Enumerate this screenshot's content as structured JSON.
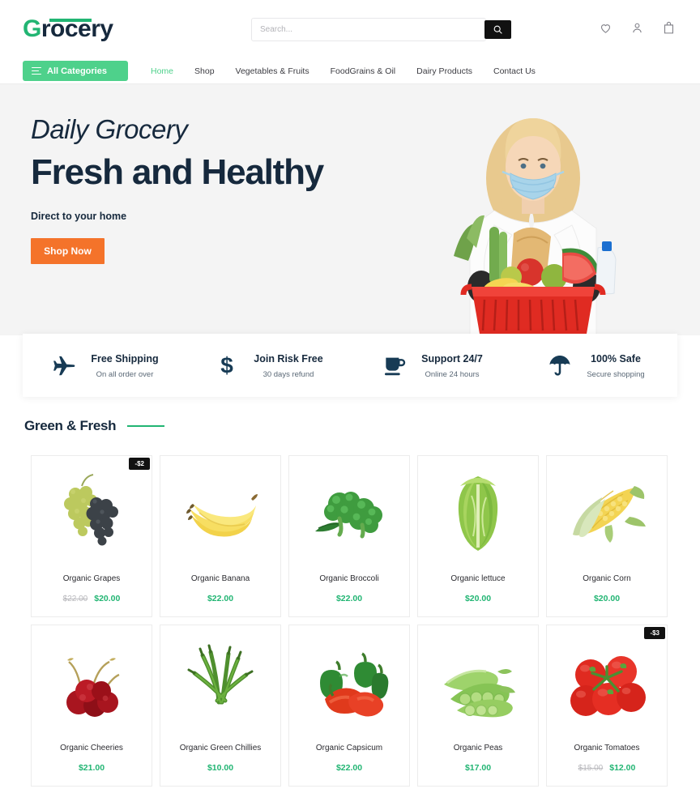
{
  "header": {
    "logo": {
      "accent_letter": "G",
      "rest": "rocery",
      "accent_color": "#22b573",
      "text_color": "#16293d"
    },
    "search": {
      "placeholder": "Search...",
      "value": "",
      "button_icon": "search-icon"
    },
    "icons": [
      {
        "name": "wishlist-icon",
        "label": "heart-icon"
      },
      {
        "name": "account-icon",
        "label": "user-icon"
      },
      {
        "name": "cart-icon",
        "label": "shopping-bag-icon"
      }
    ]
  },
  "nav": {
    "all_categories_label": "All Categories",
    "links": [
      {
        "label": "Home",
        "active": true
      },
      {
        "label": "Shop",
        "active": false
      },
      {
        "label": "Vegetables & Fruits",
        "active": false
      },
      {
        "label": "FoodGrains & Oil",
        "active": false
      },
      {
        "label": "Dairy Products",
        "active": false
      },
      {
        "label": "Contact Us",
        "active": false
      }
    ],
    "active_color": "#4ed18b",
    "button_color": "#4ed18b"
  },
  "hero": {
    "kicker": "Daily Grocery",
    "title": "Fresh and Healthy",
    "subtitle": "Direct to your home",
    "cta_label": "Shop Now",
    "cta_color": "#f4732a",
    "background": "#f4f4f4",
    "image_alt": "woman-with-mask-holding-grocery-basket"
  },
  "features": [
    {
      "icon": "airplane-icon",
      "title": "Free Shipping",
      "subtitle": "On all order over"
    },
    {
      "icon": "dollar-icon",
      "title": "Join Risk Free",
      "subtitle": "30 days refund"
    },
    {
      "icon": "coffee-cup-icon",
      "title": "Support 24/7",
      "subtitle": "Online 24 hours"
    },
    {
      "icon": "umbrella-icon",
      "title": "100% Safe",
      "subtitle": "Secure shopping"
    }
  ],
  "section": {
    "title": "Green & Fresh",
    "rule_color": "#22b573"
  },
  "products": [
    {
      "name": "Organic Grapes",
      "price": "$20.00",
      "old_price": "$22.00",
      "badge": "-$2",
      "image": "grapes-image"
    },
    {
      "name": "Organic Banana",
      "price": "$22.00",
      "old_price": "",
      "badge": "",
      "image": "banana-image"
    },
    {
      "name": "Organic Broccoli",
      "price": "$22.00",
      "old_price": "",
      "badge": "",
      "image": "broccoli-image"
    },
    {
      "name": "Organic lettuce",
      "price": "$20.00",
      "old_price": "",
      "badge": "",
      "image": "lettuce-image"
    },
    {
      "name": "Organic Corn",
      "price": "$20.00",
      "old_price": "",
      "badge": "",
      "image": "corn-image"
    },
    {
      "name": "Organic Cheeries",
      "price": "$21.00",
      "old_price": "",
      "badge": "",
      "image": "cherries-image"
    },
    {
      "name": "Organic Green Chillies",
      "price": "$10.00",
      "old_price": "",
      "badge": "",
      "image": "green-chillies-image"
    },
    {
      "name": "Organic Capsicum",
      "price": "$22.00",
      "old_price": "",
      "badge": "",
      "image": "capsicum-image"
    },
    {
      "name": "Organic Peas",
      "price": "$17.00",
      "old_price": "",
      "badge": "",
      "image": "peas-image"
    },
    {
      "name": "Organic Tomatoes",
      "price": "$12.00",
      "old_price": "$15.00",
      "badge": "-$3",
      "image": "tomatoes-image"
    }
  ]
}
